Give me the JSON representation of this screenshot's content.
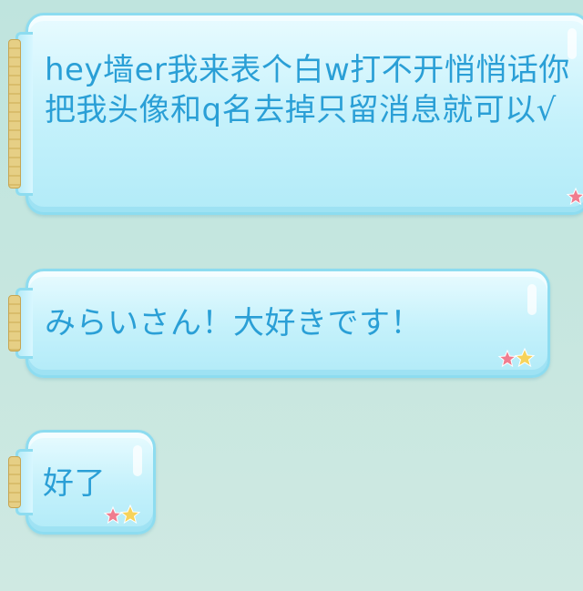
{
  "messages": [
    {
      "text": "hey墙er我来表个白w打不开悄悄话你把我头像和q名去掉只留消息就可以√"
    },
    {
      "text": "みらいさん！大好きです！"
    },
    {
      "text": "好了"
    }
  ],
  "colors": {
    "text": "#2a9fd6",
    "bubble": "#c4f1fb",
    "bubble_border": "#8ddcf0",
    "background": "#c5e6df",
    "cork": "#e6cf85"
  },
  "icons": [
    "cork-icon",
    "stars-icon"
  ]
}
